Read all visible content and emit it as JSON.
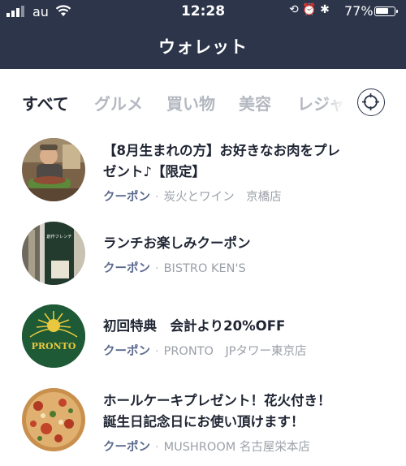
{
  "status": {
    "carrier": "au",
    "time": "12:28",
    "battery_percent": "77%",
    "battery_level": 0.77
  },
  "header": {
    "title": "ウォレット"
  },
  "tabs": [
    {
      "label": "すべて",
      "active": true
    },
    {
      "label": "グルメ",
      "active": false
    },
    {
      "label": "買い物",
      "active": false
    },
    {
      "label": "美容",
      "active": false
    },
    {
      "label": "レジャ",
      "active": false
    }
  ],
  "items": [
    {
      "title_lines": [
        "【8月生まれの方】お好きなお肉をプレ",
        "ゼント♪【限定】"
      ],
      "type": "クーポン",
      "shop": "炭火とワイン　京橋店"
    },
    {
      "title_lines": [
        "ランチお楽しみクーポン"
      ],
      "type": "クーポン",
      "shop": "BISTRO KEN'S",
      "avatar_text": "創作フレンチ"
    },
    {
      "title_lines": [
        "初回特典　会計より20%OFF"
      ],
      "type": "クーポン",
      "shop": "PRONTO　JPタワー東京店",
      "avatar_text": "PRONTO"
    },
    {
      "title_lines": [
        "ホールケーキプレゼント！花火付き！",
        "誕生日記念日にお使い頂けます！"
      ],
      "type": "クーポン",
      "shop": "MUSHROOM 名古屋栄本店"
    }
  ],
  "colors": {
    "header_bg": "#2c354a",
    "coupon_label": "#5b6a8f",
    "tab_inactive": "#b4b8c0"
  }
}
